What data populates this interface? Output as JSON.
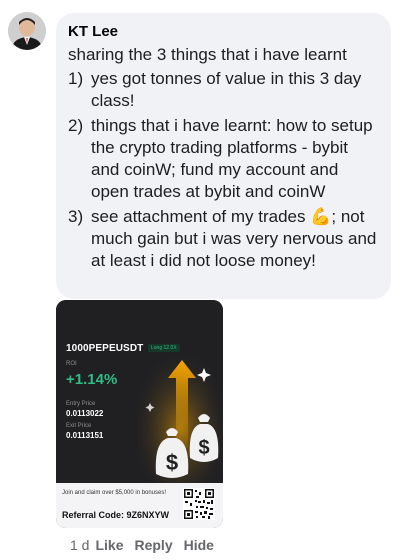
{
  "comment": {
    "author": "KT Lee",
    "intro": "sharing the 3 things that i have learnt",
    "items": [
      {
        "num": "1)",
        "text": "yes got tonnes of value in this 3 day class!"
      },
      {
        "num": "2)",
        "text": "things that i have learnt: how to setup the crypto trading platforms - bybit and coinW; fund my account and open trades at bybit and coinW"
      },
      {
        "num": "3)",
        "text_before": "see attachment of my trades ",
        "emoji": "💪",
        "text_after": "; not much gain but i was very nervous and at least i did not loose money!"
      }
    ]
  },
  "attachment": {
    "ticker": "1000PEPEUSDT",
    "leverage": "Long 12.0X",
    "roi_label": "ROI",
    "roi_value": "+1.14%",
    "entry_label": "Entry Price",
    "entry_value": "0.0113022",
    "exit_label": "Exit Price",
    "exit_value": "0.0113151",
    "promo": "Join and claim over $5,000 in bonuses!",
    "referral": "Referral Code: 9Z6NXYW",
    "colors": {
      "profit": "#2ebd85",
      "accent": "#f7a600"
    }
  },
  "actions": {
    "time": "1 d",
    "like": "Like",
    "reply": "Reply",
    "hide": "Hide"
  }
}
